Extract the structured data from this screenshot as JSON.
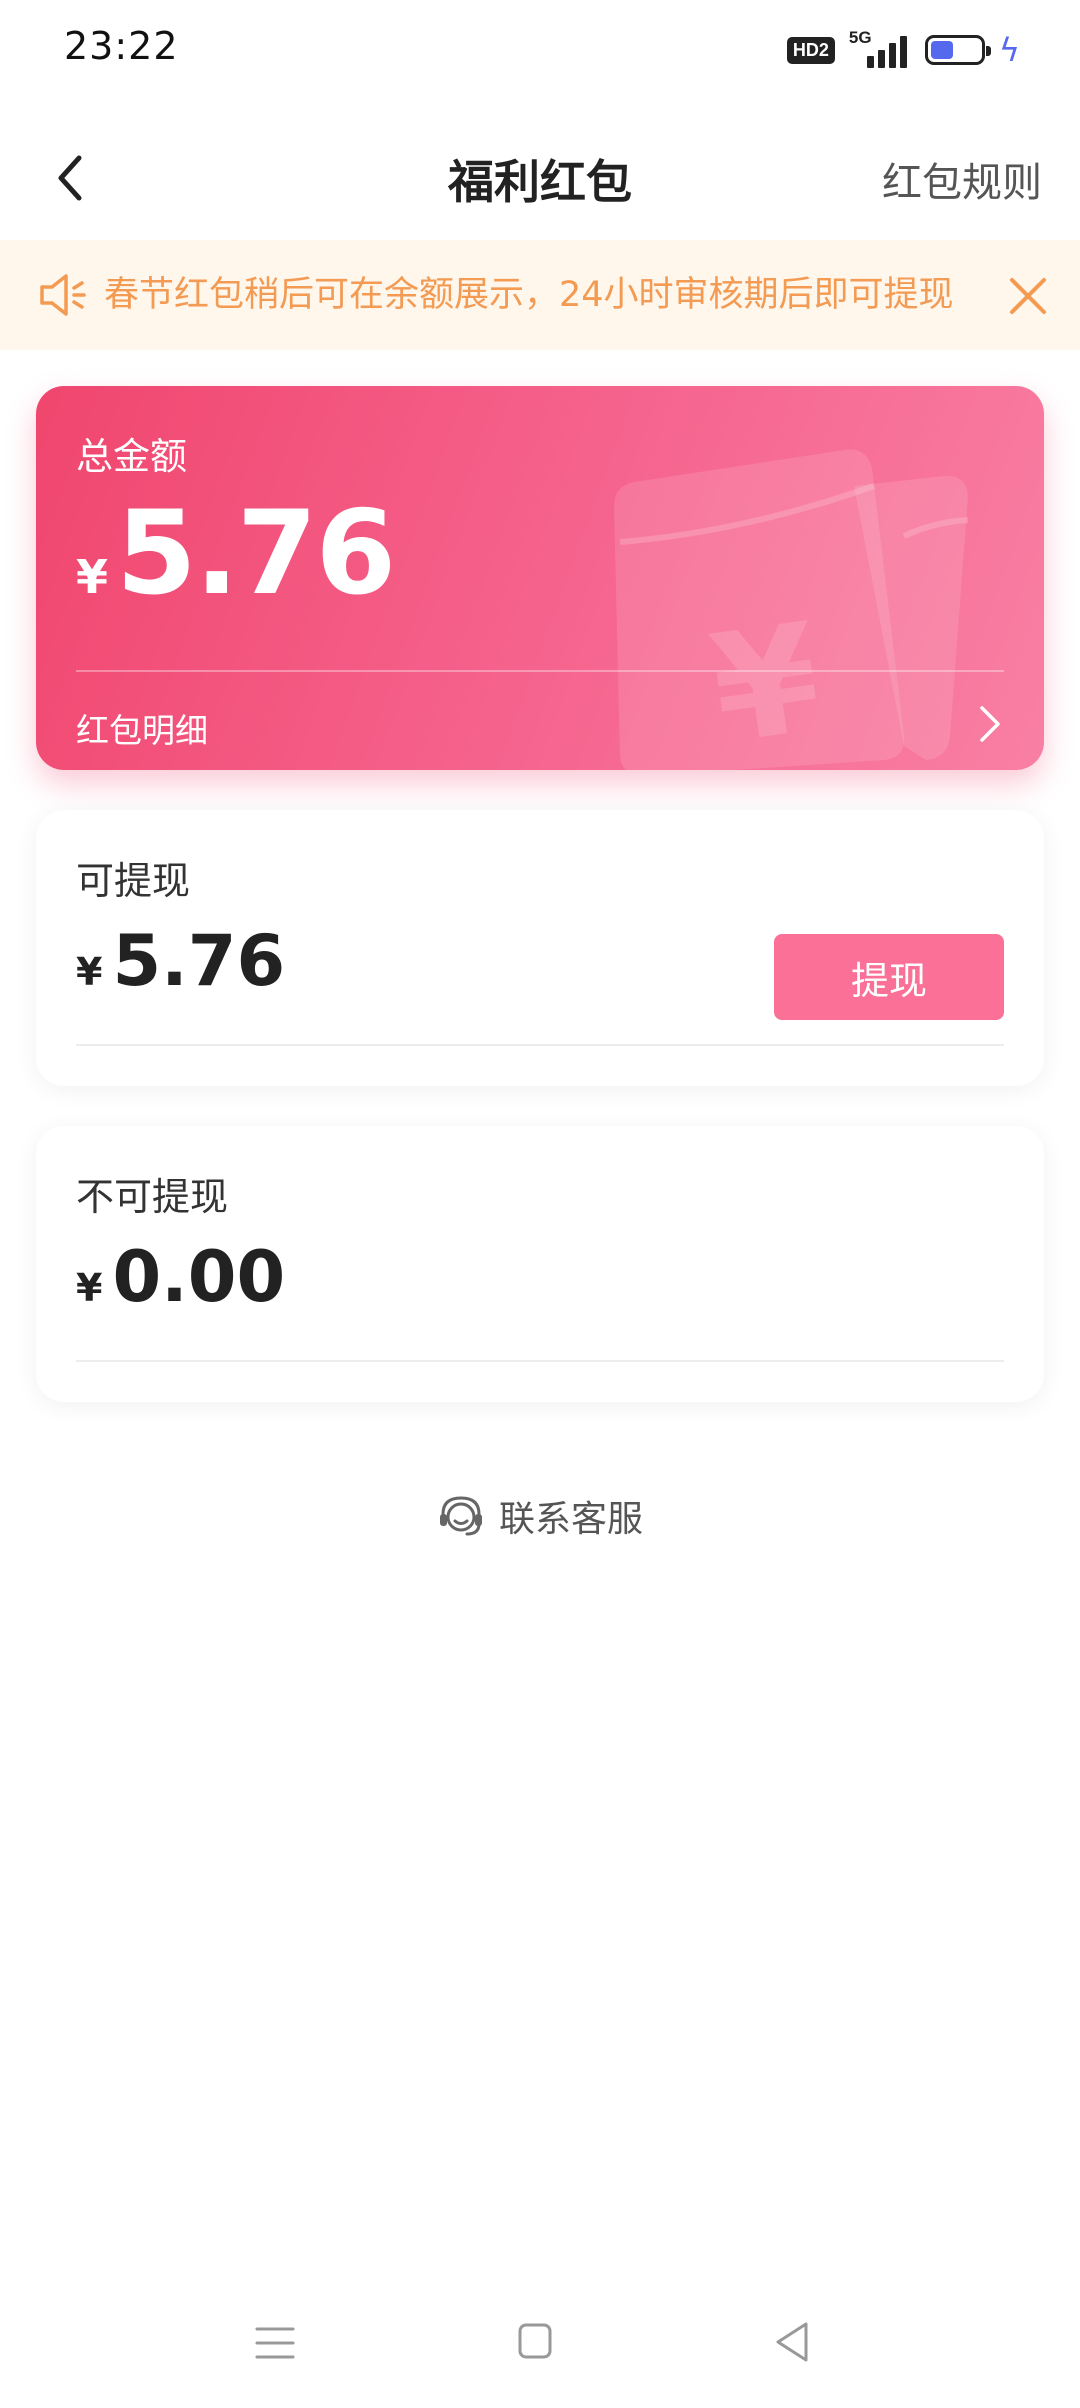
{
  "status_bar": {
    "time": "23:22",
    "hd_label": "HD2",
    "network_label": "5G",
    "battery_icon": "battery-icon",
    "charging_icon": "bolt-icon",
    "accent_color": "#5469ee"
  },
  "header": {
    "title": "福利红包",
    "rules_link": "红包规则",
    "back_icon": "chevron-left-icon"
  },
  "notice": {
    "icon": "speaker-icon",
    "text": "春节红包稍后可在余额展示，24小时审核期后即可提现",
    "close_icon": "close-icon",
    "text_color": "#f39b53",
    "background": "#fff6ec"
  },
  "total_card": {
    "label": "总金额",
    "currency": "¥",
    "amount": "5.76",
    "detail_link": "红包明细",
    "gradient_start": "#f0466e",
    "gradient_end": "#f97fa4"
  },
  "withdrawable": {
    "label": "可提现",
    "currency": "¥",
    "amount": "5.76",
    "button_label": "提现",
    "button_color": "#fa7096"
  },
  "non_withdrawable": {
    "label": "不可提现",
    "currency": "¥",
    "amount": "0.00"
  },
  "contact": {
    "icon": "headset-icon",
    "label": "联系客服"
  },
  "nav_bar": {
    "menu_icon": "menu-icon",
    "home_icon": "home-square-icon",
    "back_icon": "triangle-back-icon"
  }
}
